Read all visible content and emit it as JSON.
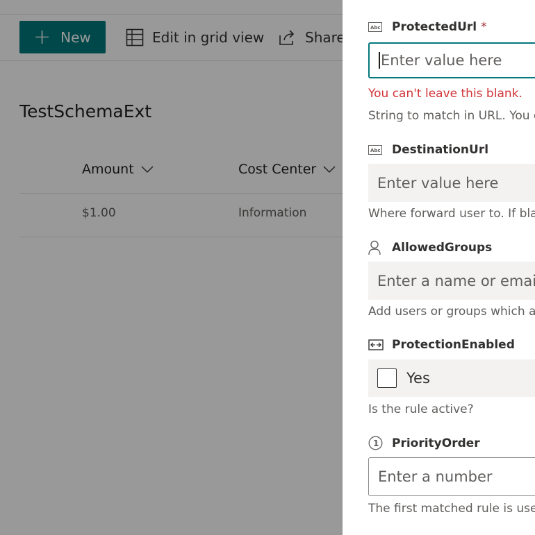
{
  "list_page": {
    "command_bar": {
      "new_label": "New",
      "edit_grid_label": "Edit in grid view",
      "share_label": "Share"
    },
    "title": "TestSchemaExt",
    "columns": [
      "Amount",
      "Cost Center"
    ],
    "rows": [
      {
        "amount": "$1.00",
        "cost_center": "Information"
      }
    ]
  },
  "panel": {
    "protected_url": {
      "label": "ProtectedUrl",
      "required_mark": "*",
      "placeholder": "Enter value here",
      "error": "You can't leave this blank.",
      "description": "String to match in URL. You ca"
    },
    "destination_url": {
      "label": "DestinationUrl",
      "placeholder": "Enter value here",
      "description": "Where forward user to. If blank"
    },
    "allowed_groups": {
      "label": "AllowedGroups",
      "placeholder": "Enter a name or email ac",
      "description": "Add users or groups which are"
    },
    "protection_enabled": {
      "label": "ProtectionEnabled",
      "checkbox_label": "Yes",
      "checked": false,
      "description": "Is the rule active?"
    },
    "priority_order": {
      "label": "PriorityOrder",
      "placeholder": "Enter a number",
      "description": "The first matched rule is used."
    }
  },
  "colors": {
    "accent": "#03787c",
    "error": "#d13438",
    "required": "#a4262c",
    "overlay": "rgba(0,0,0,0.4)"
  },
  "icons": {
    "new": "plus-icon",
    "edit_grid": "grid-icon",
    "share": "share-icon",
    "text_field": "abc-text-icon",
    "person": "person-icon",
    "yes_no": "toggle-icon",
    "number": "number-circle-icon"
  }
}
